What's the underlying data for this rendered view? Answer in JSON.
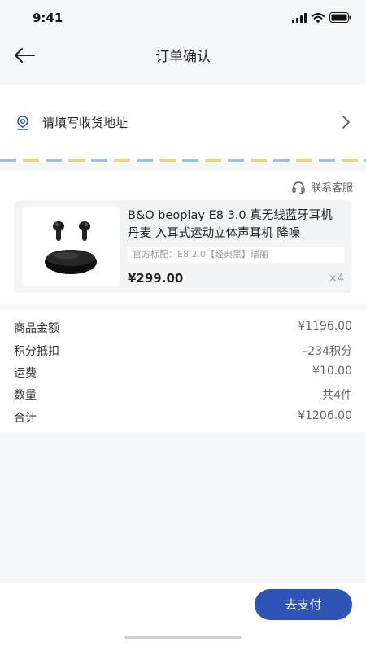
{
  "status_bar": {
    "time": "9:41"
  },
  "nav": {
    "title": "订单确认"
  },
  "address": {
    "placeholder": "请填写收货地址"
  },
  "contact": {
    "label": "联系客服"
  },
  "product": {
    "name": "B&O beoplay  E8 3.0 真无线蓝牙耳机丹麦 入耳式运动立体声耳机 降噪",
    "spec": "官方标配：E8 2.0【经典黑】瑞丽",
    "price": "¥299.00",
    "quantity": "×4"
  },
  "summary": {
    "rows": [
      {
        "label": "商品金额",
        "value": "¥1196.00"
      },
      {
        "label": "积分抵扣",
        "value": "–234积分"
      },
      {
        "label": "运费",
        "value": "¥10.00"
      },
      {
        "label": "数量",
        "value": "共4件"
      },
      {
        "label": "合计",
        "value": "¥1206.00"
      }
    ]
  },
  "actions": {
    "pay_label": "去支付"
  },
  "colors": {
    "accent": "#2f54b8",
    "background": "#f5f6f8",
    "card": "#f3f4f6"
  },
  "icons": [
    "signal-icon",
    "wifi-icon",
    "battery-icon",
    "back-arrow-icon",
    "location-pin-icon",
    "chevron-right-icon",
    "headset-icon"
  ]
}
